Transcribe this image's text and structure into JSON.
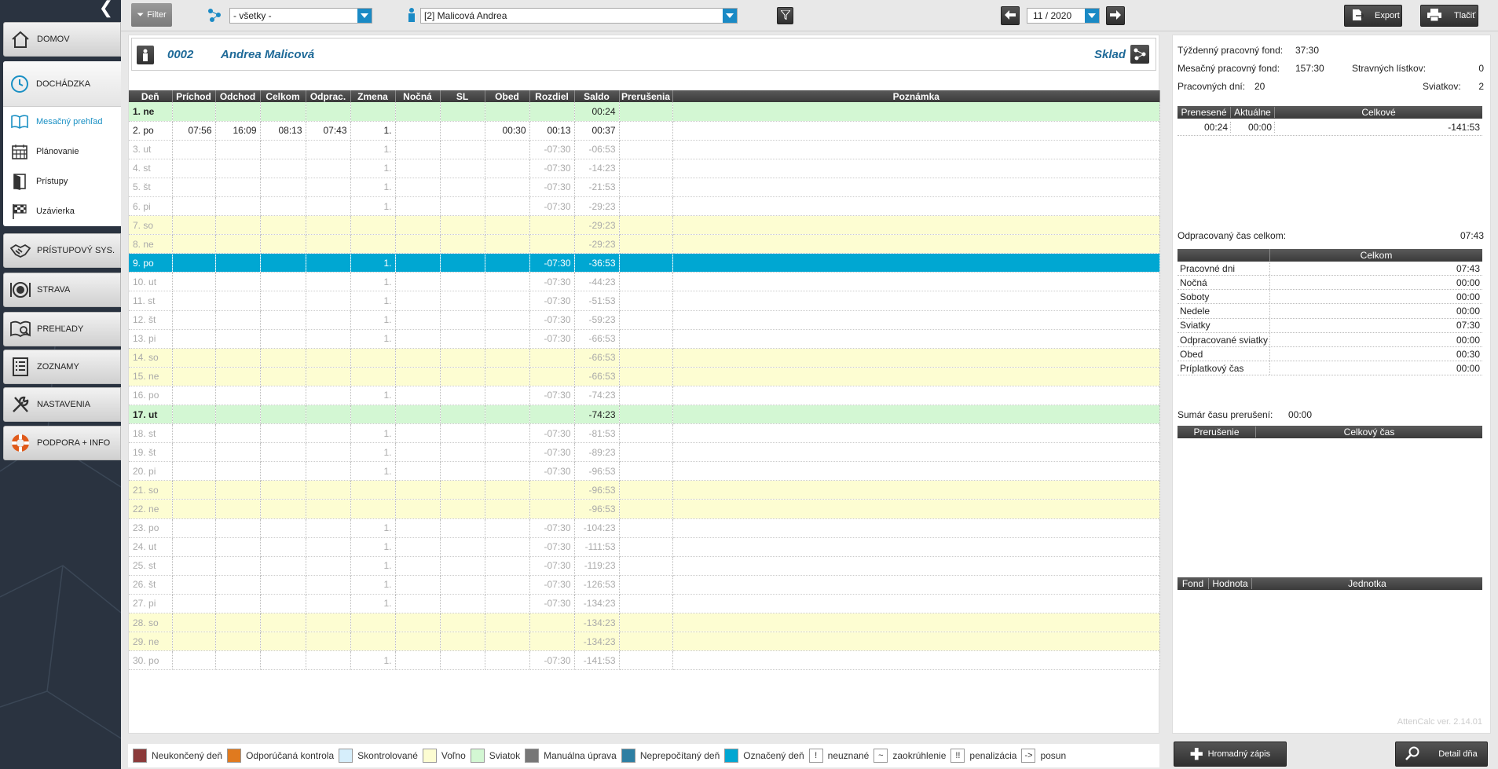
{
  "sidebar": {
    "nav": [
      {
        "label": "DOMOV",
        "icon": "home-icon"
      },
      {
        "label": "PRÍSTUPOVÝ SYS.",
        "icon": "handshake-icon"
      },
      {
        "label": "STRAVA",
        "icon": "plate-icon"
      },
      {
        "label": "PREHĽADY",
        "icon": "overview-icon"
      },
      {
        "label": "ZOZNAMY",
        "icon": "list-icon"
      },
      {
        "label": "NASTAVENIA",
        "icon": "tools-icon"
      },
      {
        "label": "PODPORA + INFO",
        "icon": "lifebuoy-icon"
      }
    ],
    "attendance": {
      "label": "DOCHÁDZKA",
      "items": [
        {
          "label": "Mesačný prehľad"
        },
        {
          "label": "Plánovanie"
        },
        {
          "label": "Prístupy"
        },
        {
          "label": "Uzávierka"
        }
      ]
    }
  },
  "topbar": {
    "filter_label": "Filter",
    "group_value": "- všetky -",
    "employee_value": "[2] Malicová Andrea",
    "period_value": "11 / 2020",
    "export_label": "Export",
    "print_label": "Tlačiť"
  },
  "employee": {
    "number": "0002",
    "name": "Andrea Malicová",
    "department": "Sklad"
  },
  "grid": {
    "columns": [
      "Deň",
      "Príchod",
      "Odchod",
      "Celkom",
      "Odprac.",
      "Zmena",
      "Nočná",
      "SL",
      "Obed",
      "Rozdiel",
      "Saldo",
      "Prerušenia",
      "Poznámka"
    ],
    "rows": [
      {
        "t": "hol",
        "c": [
          "1. ne",
          "",
          "",
          "",
          "",
          "",
          "",
          "",
          "",
          "",
          "00:24",
          "",
          ""
        ]
      },
      {
        "t": "worked",
        "c": [
          "2. po",
          "07:56",
          "16:09",
          "08:13",
          "07:43",
          "1.",
          "",
          "",
          "00:30",
          "00:13",
          "00:37",
          "",
          ""
        ]
      },
      {
        "t": "work",
        "c": [
          "3. ut",
          "",
          "",
          "",
          "",
          "1.",
          "",
          "",
          "",
          "-07:30",
          "-06:53",
          "",
          ""
        ]
      },
      {
        "t": "work",
        "c": [
          "4. st",
          "",
          "",
          "",
          "",
          "1.",
          "",
          "",
          "",
          "-07:30",
          "-14:23",
          "",
          ""
        ]
      },
      {
        "t": "work",
        "c": [
          "5. št",
          "",
          "",
          "",
          "",
          "1.",
          "",
          "",
          "",
          "-07:30",
          "-21:53",
          "",
          ""
        ]
      },
      {
        "t": "work",
        "c": [
          "6. pi",
          "",
          "",
          "",
          "",
          "1.",
          "",
          "",
          "",
          "-07:30",
          "-29:23",
          "",
          ""
        ]
      },
      {
        "t": "wkend",
        "c": [
          "7. so",
          "",
          "",
          "",
          "",
          "",
          "",
          "",
          "",
          "",
          "-29:23",
          "",
          ""
        ]
      },
      {
        "t": "wkend",
        "c": [
          "8. ne",
          "",
          "",
          "",
          "",
          "",
          "",
          "",
          "",
          "",
          "-29:23",
          "",
          ""
        ]
      },
      {
        "t": "mark",
        "c": [
          "9. po",
          "",
          "",
          "",
          "",
          "1.",
          "",
          "",
          "",
          "-07:30",
          "-36:53",
          "",
          ""
        ]
      },
      {
        "t": "work",
        "c": [
          "10. ut",
          "",
          "",
          "",
          "",
          "1.",
          "",
          "",
          "",
          "-07:30",
          "-44:23",
          "",
          ""
        ]
      },
      {
        "t": "work",
        "c": [
          "11. st",
          "",
          "",
          "",
          "",
          "1.",
          "",
          "",
          "",
          "-07:30",
          "-51:53",
          "",
          ""
        ]
      },
      {
        "t": "work",
        "c": [
          "12. št",
          "",
          "",
          "",
          "",
          "1.",
          "",
          "",
          "",
          "-07:30",
          "-59:23",
          "",
          ""
        ]
      },
      {
        "t": "work",
        "c": [
          "13. pi",
          "",
          "",
          "",
          "",
          "1.",
          "",
          "",
          "",
          "-07:30",
          "-66:53",
          "",
          ""
        ]
      },
      {
        "t": "wkend",
        "c": [
          "14. so",
          "",
          "",
          "",
          "",
          "",
          "",
          "",
          "",
          "",
          "-66:53",
          "",
          ""
        ]
      },
      {
        "t": "wkend",
        "c": [
          "15. ne",
          "",
          "",
          "",
          "",
          "",
          "",
          "",
          "",
          "",
          "-66:53",
          "",
          ""
        ]
      },
      {
        "t": "work",
        "c": [
          "16. po",
          "",
          "",
          "",
          "",
          "1.",
          "",
          "",
          "",
          "-07:30",
          "-74:23",
          "",
          ""
        ]
      },
      {
        "t": "hol",
        "c": [
          "17. ut",
          "",
          "",
          "",
          "",
          "",
          "",
          "",
          "",
          "",
          "-74:23",
          "",
          ""
        ]
      },
      {
        "t": "work",
        "c": [
          "18. st",
          "",
          "",
          "",
          "",
          "1.",
          "",
          "",
          "",
          "-07:30",
          "-81:53",
          "",
          ""
        ]
      },
      {
        "t": "work",
        "c": [
          "19. št",
          "",
          "",
          "",
          "",
          "1.",
          "",
          "",
          "",
          "-07:30",
          "-89:23",
          "",
          ""
        ]
      },
      {
        "t": "work",
        "c": [
          "20. pi",
          "",
          "",
          "",
          "",
          "1.",
          "",
          "",
          "",
          "-07:30",
          "-96:53",
          "",
          ""
        ]
      },
      {
        "t": "wkend",
        "c": [
          "21. so",
          "",
          "",
          "",
          "",
          "",
          "",
          "",
          "",
          "",
          "-96:53",
          "",
          ""
        ]
      },
      {
        "t": "wkend",
        "c": [
          "22. ne",
          "",
          "",
          "",
          "",
          "",
          "",
          "",
          "",
          "",
          "-96:53",
          "",
          ""
        ]
      },
      {
        "t": "work",
        "c": [
          "23. po",
          "",
          "",
          "",
          "",
          "1.",
          "",
          "",
          "",
          "-07:30",
          "-104:23",
          "",
          ""
        ]
      },
      {
        "t": "work",
        "c": [
          "24. ut",
          "",
          "",
          "",
          "",
          "1.",
          "",
          "",
          "",
          "-07:30",
          "-111:53",
          "",
          ""
        ]
      },
      {
        "t": "work",
        "c": [
          "25. st",
          "",
          "",
          "",
          "",
          "1.",
          "",
          "",
          "",
          "-07:30",
          "-119:23",
          "",
          ""
        ]
      },
      {
        "t": "work",
        "c": [
          "26. št",
          "",
          "",
          "",
          "",
          "1.",
          "",
          "",
          "",
          "-07:30",
          "-126:53",
          "",
          ""
        ]
      },
      {
        "t": "work",
        "c": [
          "27. pi",
          "",
          "",
          "",
          "",
          "1.",
          "",
          "",
          "",
          "-07:30",
          "-134:23",
          "",
          ""
        ]
      },
      {
        "t": "wkend",
        "c": [
          "28. so",
          "",
          "",
          "",
          "",
          "",
          "",
          "",
          "",
          "",
          "-134:23",
          "",
          ""
        ]
      },
      {
        "t": "wkend",
        "c": [
          "29. ne",
          "",
          "",
          "",
          "",
          "",
          "",
          "",
          "",
          "",
          "-134:23",
          "",
          ""
        ]
      },
      {
        "t": "work",
        "c": [
          "30. po",
          "",
          "",
          "",
          "",
          "1.",
          "",
          "",
          "",
          "-07:30",
          "-141:53",
          "",
          ""
        ]
      }
    ]
  },
  "summary": {
    "weekly_fund_label": "Týždenný pracovný fond:",
    "weekly_fund_value": "37:30",
    "monthly_fund_label": "Mesačný pracovný fond:",
    "monthly_fund_value": "157:30",
    "meal_label": "Stravných lístkov:",
    "meal_value": "0",
    "workdays_label": "Pracovných dní:",
    "workdays_value": "20",
    "holidays_label": "Sviatkov:",
    "holidays_value": "2",
    "balance_headers": [
      "Prenesené",
      "Aktuálne",
      "Celkové"
    ],
    "balance_values": [
      "00:24",
      "00:00",
      "-141:53"
    ],
    "worked_total_label": "Odpracovaný čas celkom:",
    "worked_total_value": "07:43",
    "worked_header": "Celkom",
    "worked_rows": [
      {
        "label": "Pracovné dni",
        "value": "07:43"
      },
      {
        "label": "Nočná",
        "value": "00:00"
      },
      {
        "label": "Soboty",
        "value": "00:00"
      },
      {
        "label": "Nedele",
        "value": "00:00"
      },
      {
        "label": "Sviatky",
        "value": "07:30"
      },
      {
        "label": "Odpracované sviatky",
        "value": "00:00"
      },
      {
        "label": "Obed",
        "value": "00:30"
      },
      {
        "label": "Príplatkový čas",
        "value": "00:00"
      }
    ],
    "break_sum_label": "Sumár času prerušení:",
    "break_sum_value": "00:00",
    "break_headers": [
      "Prerušenie",
      "Celkový čas"
    ],
    "fund_headers": [
      "Fond",
      "Hodnota",
      "Jednotka"
    ],
    "version": "AttenCalc ver. 2.14.01"
  },
  "legend": [
    {
      "label": "Neukončený deň",
      "color": "#8b3a3a"
    },
    {
      "label": "Odporúčaná kontrola",
      "color": "#e07a1f"
    },
    {
      "label": "Skontrolované",
      "color": "#d6eefb"
    },
    {
      "label": "Voľno",
      "color": "#fdfdd2"
    },
    {
      "label": "Sviatok",
      "color": "#d3f7d3"
    },
    {
      "label": "Manuálna úprava",
      "color": "#777777"
    },
    {
      "label": "Neprepočítaný deň",
      "color": "#2d7fa3"
    },
    {
      "label": "Označený deň",
      "color": "#00a7d2"
    }
  ],
  "legend_symbols": [
    {
      "sym": "!",
      "label": "neuznané"
    },
    {
      "sym": "~",
      "label": "zaokrúhlenie"
    },
    {
      "sym": "!!",
      "label": "penalizácia"
    },
    {
      "sym": "->",
      "label": "posun"
    }
  ],
  "bottom_buttons": {
    "bulk_label": "Hromadný zápis",
    "detail_label": "Detail dňa"
  }
}
